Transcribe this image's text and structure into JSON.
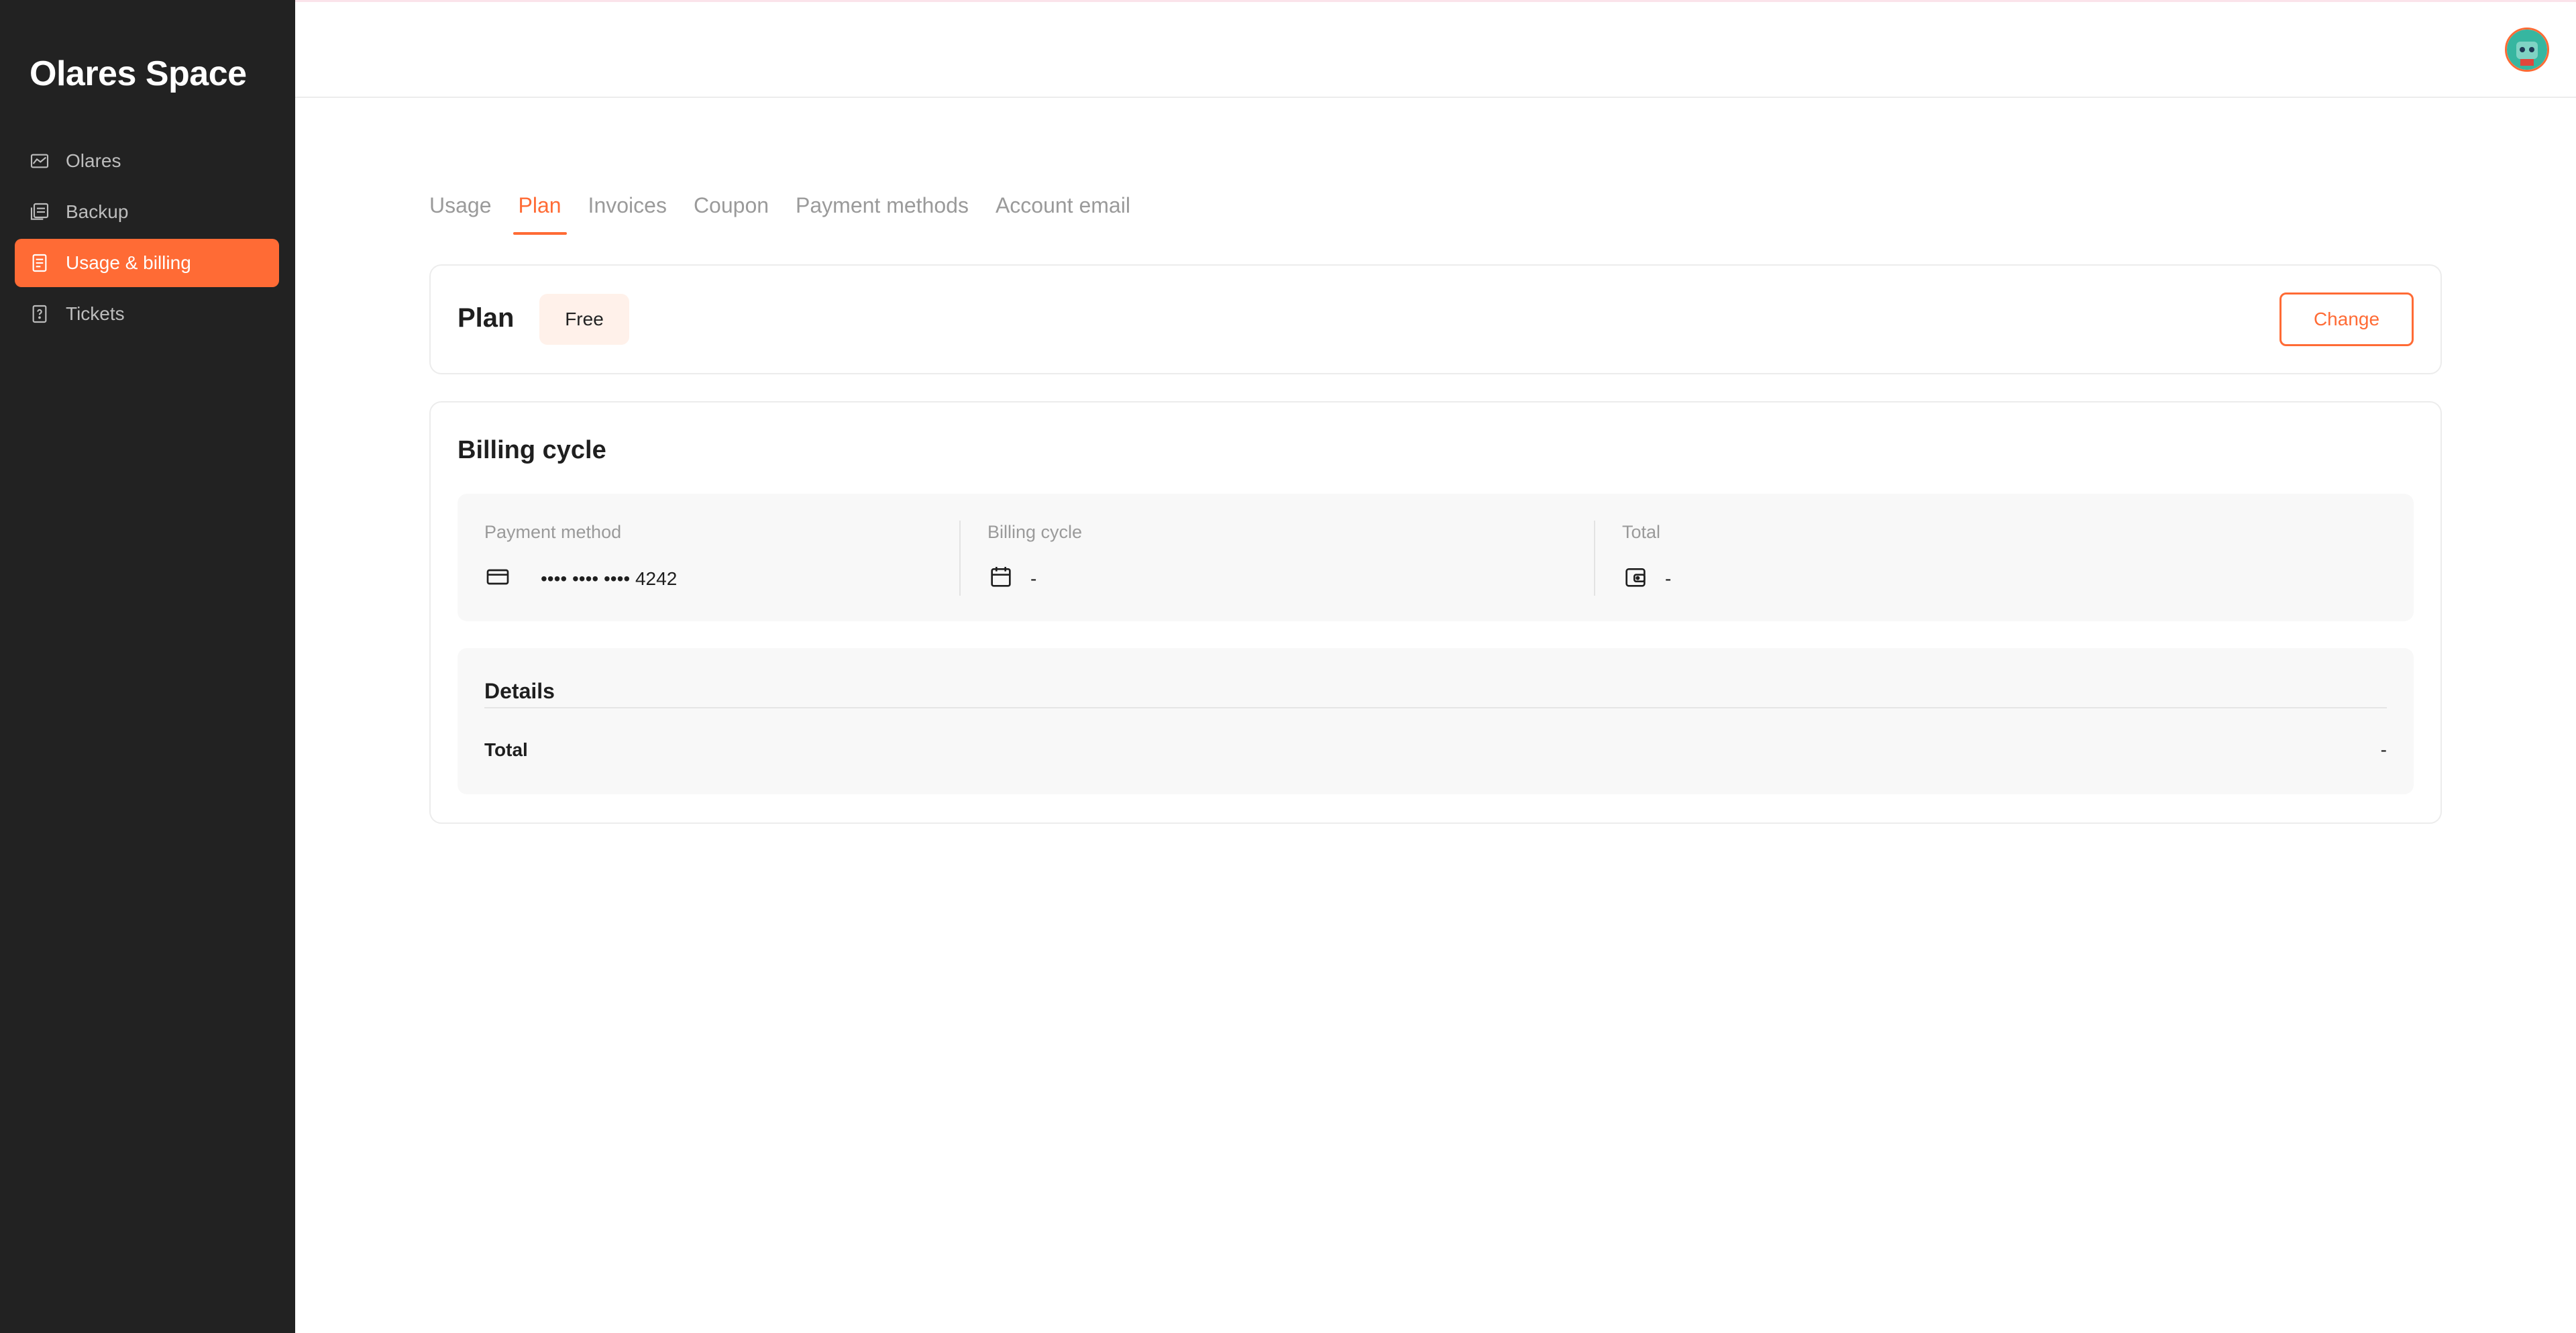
{
  "sidebar": {
    "brand": "Olares Space",
    "items": [
      {
        "label": "Olares",
        "icon": "chart-icon"
      },
      {
        "label": "Backup",
        "icon": "backup-icon"
      },
      {
        "label": "Usage & billing",
        "icon": "billing-icon",
        "active": true
      },
      {
        "label": "Tickets",
        "icon": "ticket-icon"
      }
    ]
  },
  "header": {
    "avatar": "user-avatar"
  },
  "tabs": [
    {
      "label": "Usage"
    },
    {
      "label": "Plan",
      "active": true
    },
    {
      "label": "Invoices"
    },
    {
      "label": "Coupon"
    },
    {
      "label": "Payment methods"
    },
    {
      "label": "Account email"
    }
  ],
  "plan": {
    "title": "Plan",
    "badge": "Free",
    "change_label": "Change"
  },
  "billing": {
    "title": "Billing cycle",
    "payment_method_label": "Payment method",
    "payment_method_value": "•••• •••• •••• 4242",
    "cycle_label": "Billing cycle",
    "cycle_value": "-",
    "total_label": "Total",
    "total_value": "-"
  },
  "details": {
    "title": "Details",
    "total_label": "Total",
    "total_value": "-"
  },
  "colors": {
    "accent": "#ff6b35",
    "sidebar_bg": "#222222",
    "badge_bg": "#fff1ea"
  }
}
